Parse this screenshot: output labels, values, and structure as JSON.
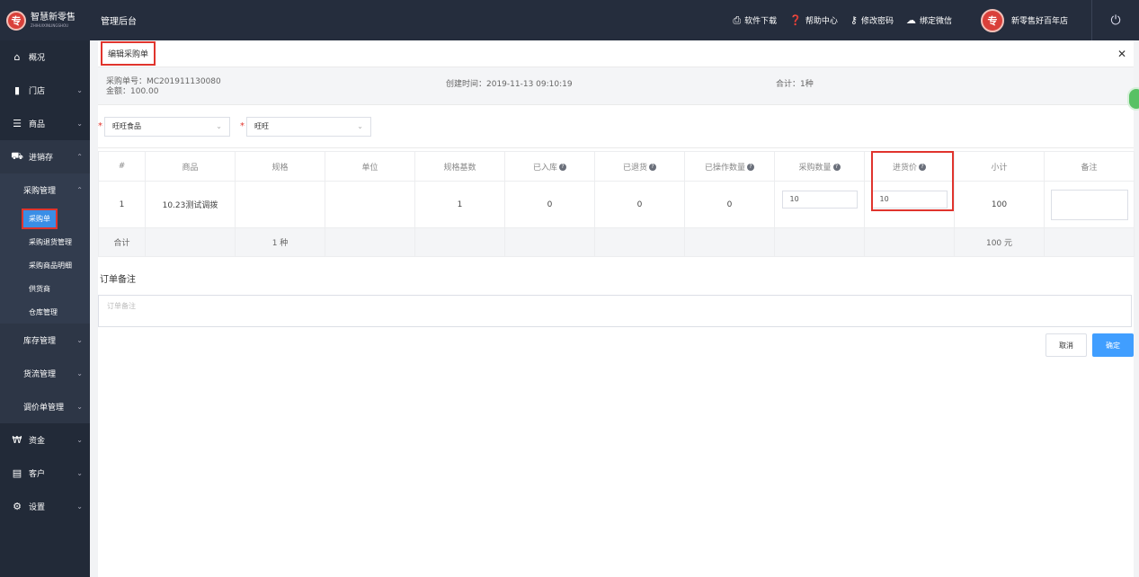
{
  "brand": {
    "name": "智慧新零售",
    "sub": "ZHIHUIXINLINGSHOU",
    "glyph": "专"
  },
  "header": {
    "title": "管理后台",
    "actions": [
      {
        "icon": "printer-icon",
        "label": "软件下载"
      },
      {
        "icon": "help-icon",
        "label": "帮助中心"
      },
      {
        "icon": "key-icon",
        "label": "修改密码"
      },
      {
        "icon": "wechat-icon",
        "label": "绑定微信"
      }
    ],
    "store_name": "新零售好百年店"
  },
  "sidebar": {
    "items": [
      {
        "label": "概况",
        "icon": "home-icon"
      },
      {
        "label": "门店",
        "icon": "store-icon"
      },
      {
        "label": "商品",
        "icon": "list-icon"
      },
      {
        "label": "进销存",
        "icon": "truck-icon"
      }
    ],
    "purchase_group": "采购管理",
    "leaves": [
      "采购单",
      "采购退货管理",
      "采购商品明细",
      "供货商",
      "仓库管理"
    ],
    "sub_groups": [
      "库存管理",
      "货流管理",
      "调价单管理"
    ],
    "bottom_items": [
      {
        "label": "资金",
        "icon": "won-icon"
      },
      {
        "label": "客户",
        "icon": "id-card-icon"
      },
      {
        "label": "设置",
        "icon": "gear-icon"
      }
    ]
  },
  "page": {
    "title": "编辑采购单",
    "order_no": "采购单号：MC201911130080",
    "amount": "金额：100.00",
    "created": "创建时间：2019-11-13 09:10:19",
    "total_kinds": "合计：1种",
    "supplier_select": "旺旺食品",
    "brand_select": "旺旺"
  },
  "table": {
    "headers": [
      "#",
      "商品",
      "规格",
      "单位",
      "规格基数",
      "已入库",
      "已退货",
      "已操作数量",
      "采购数量",
      "进货价",
      "小计",
      "备注"
    ],
    "row": {
      "index": "1",
      "product": "10.23测试调拨",
      "spec": "",
      "unit": "",
      "base": "1",
      "received": "0",
      "returned": "0",
      "operated": "0",
      "qty": "10",
      "price": "10",
      "subtotal": "100"
    },
    "sum": {
      "label": "合计",
      "kinds": "1 种",
      "total": "100 元"
    }
  },
  "remark": {
    "label": "订单备注",
    "placeholder": "订单备注"
  },
  "buttons": {
    "cancel": "取消",
    "ok": "确定"
  }
}
